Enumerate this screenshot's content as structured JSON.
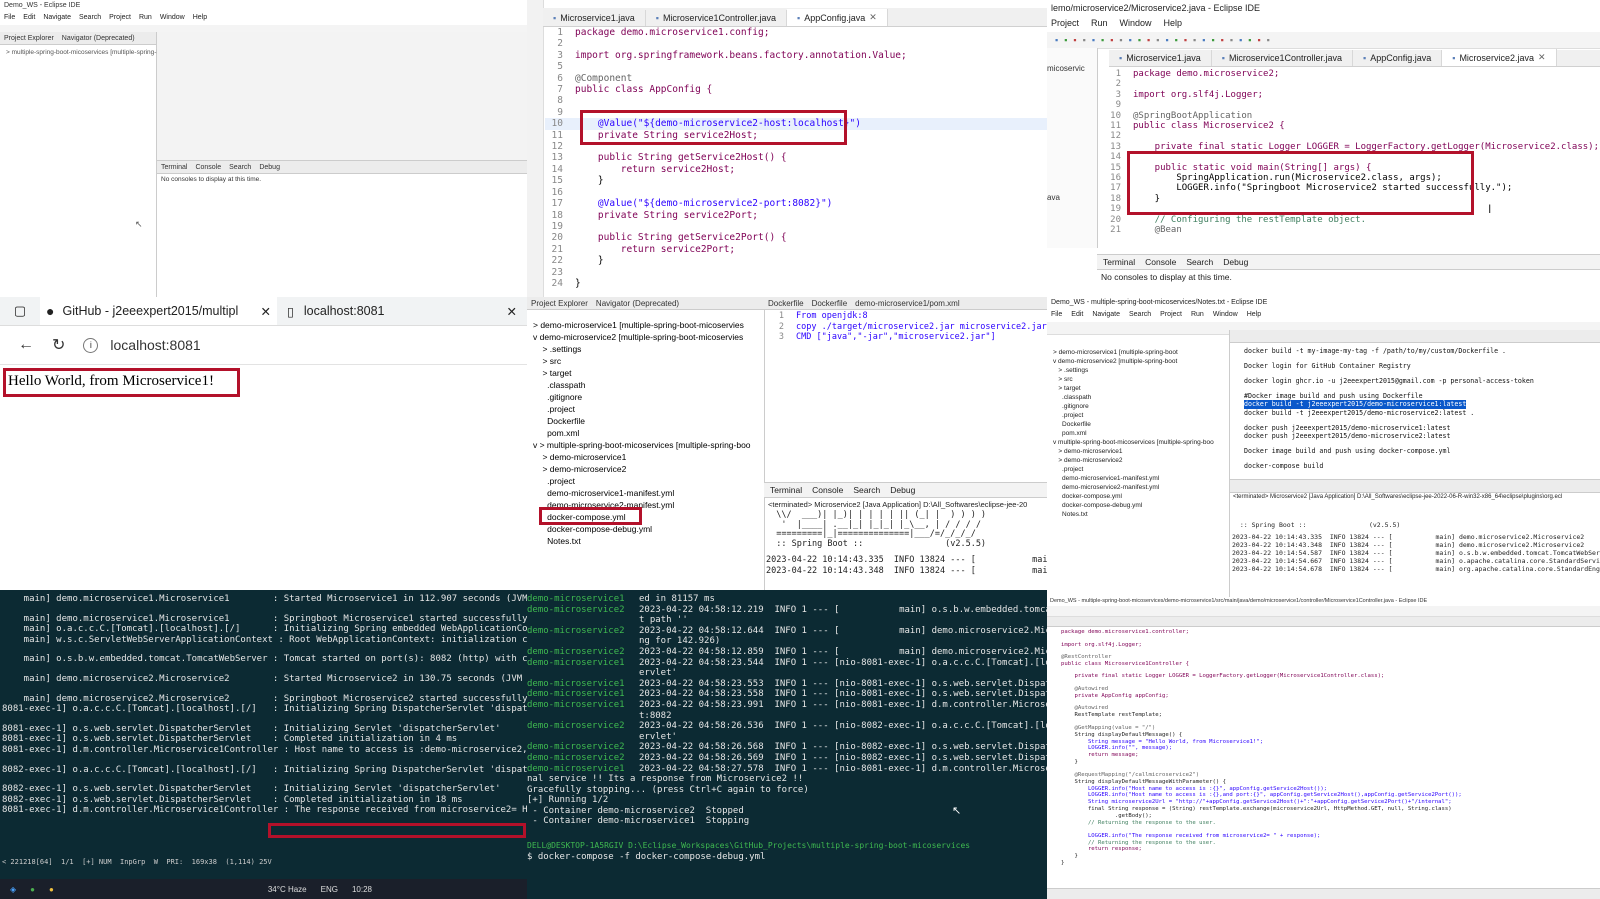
{
  "colors": {
    "highlight_box": "#b3112a",
    "terminal_bg": "#0c2a33",
    "selection": "#0a58ca"
  },
  "tl": {
    "title": "Demo_WS - Eclipse IDE",
    "menu": [
      "File",
      "Edit",
      "Navigate",
      "Search",
      "Project",
      "Run",
      "Window",
      "Help"
    ],
    "tabs": [
      "Project Explorer",
      "Navigator (Deprecated)"
    ],
    "tree_item": "> multiple-spring-boot-micoservices [multiple-spring-boo",
    "console_tabs": [
      "Terminal",
      "Console",
      "Search",
      "Debug"
    ],
    "console_msg": "No consoles to display at this time."
  },
  "tm": {
    "tabs": [
      "Microservice1.java",
      "Microservice1Controller.java",
      "AppConfig.java"
    ],
    "lines": [
      {
        "n": "1",
        "t": "package demo.microservice1.config;"
      },
      {
        "n": "2",
        "t": ""
      },
      {
        "n": "3",
        "t": "import org.springframework.beans.factory.annotation.Value;"
      },
      {
        "n": "5",
        "t": ""
      },
      {
        "n": "6",
        "t": "@Component"
      },
      {
        "n": "7",
        "t": "public class AppConfig {"
      },
      {
        "n": "8",
        "t": ""
      },
      {
        "n": "9",
        "t": ""
      },
      {
        "n": "10",
        "t": "    @Value(\"${demo-microservice2-host:localhost}\")"
      },
      {
        "n": "11",
        "t": "    private String service2Host;"
      },
      {
        "n": "12",
        "t": ""
      },
      {
        "n": "13",
        "t": "    public String getService2Host() {"
      },
      {
        "n": "14",
        "t": "        return service2Host;"
      },
      {
        "n": "15",
        "t": "    }"
      },
      {
        "n": "16",
        "t": ""
      },
      {
        "n": "17",
        "t": "    @Value(\"${demo-microservice2-port:8082}\")"
      },
      {
        "n": "18",
        "t": "    private String service2Port;"
      },
      {
        "n": "19",
        "t": ""
      },
      {
        "n": "20",
        "t": "    public String getService2Port() {"
      },
      {
        "n": "21",
        "t": "        return service2Port;"
      },
      {
        "n": "22",
        "t": "    }"
      },
      {
        "n": "23",
        "t": ""
      },
      {
        "n": "24",
        "t": "}"
      }
    ]
  },
  "tr": {
    "title": "lemo/microservice2/Microservice2.java - Eclipse IDE",
    "menu": [
      "Project",
      "Run",
      "Window",
      "Help"
    ],
    "tabs": [
      "Microservice1.java",
      "Microservice1Controller.java",
      "AppConfig.java",
      "Microservice2.java"
    ],
    "side_label": "micoservic",
    "side_label2": "ava",
    "lines": [
      {
        "n": "1",
        "t": "package demo.microservice2;"
      },
      {
        "n": "2",
        "t": ""
      },
      {
        "n": "3",
        "t": "import org.slf4j.Logger;"
      },
      {
        "n": "9",
        "t": ""
      },
      {
        "n": "10",
        "t": "@SpringBootApplication"
      },
      {
        "n": "11",
        "t": "public class Microservice2 {"
      },
      {
        "n": "12",
        "t": ""
      },
      {
        "n": "13",
        "t": "    private final static Logger LOGGER = LoggerFactory.getLogger(Microservice2.class);"
      },
      {
        "n": "14",
        "t": ""
      },
      {
        "n": "15",
        "t": "    public static void main(String[] args) {"
      },
      {
        "n": "16",
        "t": "        SpringApplication.run(Microservice2.class, args);"
      },
      {
        "n": "17",
        "t": "        LOGGER.info(\"Springboot Microservice2 started successfully.\");"
      },
      {
        "n": "18",
        "t": "    }"
      },
      {
        "n": "19",
        "t": ""
      },
      {
        "n": "20",
        "t": "    // Configuring the restTemplate object."
      },
      {
        "n": "21",
        "t": "    @Bean"
      }
    ],
    "console_tabs": [
      "Terminal",
      "Console",
      "Search",
      "Debug"
    ],
    "console_msg": "No consoles to display at this time."
  },
  "ml": {
    "tab1": "GitHub - j2eeexpert2015/multipl",
    "tab2": "localhost:8081",
    "url": "localhost:8081",
    "body": "Hello World, from Microservice1!"
  },
  "mm": {
    "tabs": [
      "Project Explorer",
      "Navigator (Deprecated)"
    ],
    "tree": [
      "> demo-microservice1 [multiple-spring-boot-micoservies",
      "v demo-microservice2 [multiple-spring-boot-micoservies",
      "    > .settings",
      "    > src",
      "    > target",
      "      .classpath",
      "      .gitignore",
      "      .project",
      "      Dockerfile",
      "      pom.xml",
      "v > multiple-spring-boot-micoservices [multiple-spring-boo",
      "    > demo-microservice1",
      "    > demo-microservice2",
      "      .project",
      "      demo-microservice1-manifest.yml",
      "      demo-microservice2-manifest.yml",
      "      docker-compose.yml",
      "      docker-compose-debug.yml",
      "      Notes.txt"
    ],
    "editor_tabs": [
      "Dockerfile",
      "Dockerfile",
      "demo-microservice1/pom.xml"
    ],
    "docker_lines": [
      {
        "n": "1",
        "t": "From openjdk:8"
      },
      {
        "n": "2",
        "t": "copy ./target/microservice2.jar microservice2.jar"
      },
      {
        "n": "3",
        "t": "CMD [\"java\",\"-jar\",\"microservice2.jar\"]"
      }
    ],
    "console_tabs": [
      "Terminal",
      "Console",
      "Search",
      "Debug"
    ],
    "console_status": "<terminated> Microservice2 [Java Application] D:\\All_Softwares\\eclipse-jee-20",
    "banner": [
      "  \\\\/  ___)| |_)| | | | | || (_| |  ) ) ) )",
      "   '  |____| .__|_| |_|_| |_\\__, | / / / /",
      "  =========|_|==============|___/=/_/_/_/",
      "  :: Spring Boot ::                (v2.5.5)"
    ],
    "log": [
      "2023-04-22 10:14:43.335  INFO 13824 --- [           main] c",
      "2023-04-22 10:14:43.348  INFO 13824 --- [           main] d"
    ]
  },
  "mr": {
    "title": "Demo_WS - multiple-spring-boot-micoservices/Notes.txt - Eclipse IDE",
    "menu": [
      "File",
      "Edit",
      "Navigate",
      "Search",
      "Project",
      "Run",
      "Window",
      "Help"
    ],
    "tree": [
      "> demo-microservice1 [multiple-spring-boot",
      "v demo-microservice2 [multiple-spring-boot",
      "   > .settings",
      "   > src",
      "   > target",
      "     .classpath",
      "     .gitignore",
      "     .project",
      "     Dockerfile",
      "     pom.xml",
      "v multiple-spring-boot-micoservices [multiple-spring-boo",
      "   > demo-microservice1",
      "   > demo-microservice2",
      "     .project",
      "     demo-microservice1-manifest.yml",
      "     demo-microservice2-manifest.yml",
      "     docker-compose.yml",
      "     docker-compose-debug.yml",
      "     Notes.txt"
    ],
    "notes": [
      "docker build -t my-image-my-tag -f /path/to/my/custom/Dockerfile .",
      "",
      "Docker login for GitHub Container Registry",
      "",
      "docker login ghcr.io -u j2eeexpert2015@gmail.com -p personal-access-token",
      "",
      "#Docker image build and push using Dockerfile",
      "docker build -t j2eeexpert2015/demo-microservice1:latest",
      "docker build -t j2eeexpert2015/demo-microservice2:latest .",
      "",
      "docker push j2eeexpert2015/demo-microservice1:latest",
      "docker push j2eeexpert2015/demo-microservice2:latest",
      "",
      "Docker image build and push using docker-compose.yml",
      "",
      "docker-compose build"
    ],
    "console_status": "<terminated> Microservice2 [Java Application] D:\\All_Softwares\\eclipse-jee-2022-06-R-win32-x86_64\\eclipse\\plugins\\org.ecl",
    "banner": "  :: Spring Boot ::                (v2.5.5)",
    "log": [
      "2023-04-22 10:14:43.335  INFO 13824 --- [           main] demo.microservice2.Microservice2",
      "2023-04-22 10:14:43.348  INFO 13824 --- [           main] demo.microservice2.Microservice2",
      "2023-04-22 10:14:54.587  INFO 13824 --- [           main] o.s.b.w.embedded.tomcat.TomcatWebServer",
      "2023-04-22 10:14:54.667  INFO 13824 --- [           main] o.apache.catalina.core.StandardService",
      "2023-04-22 10:14:54.678  INFO 13824 --- [           main] org.apache.catalina.core.StandardEngine"
    ]
  },
  "bl": {
    "lines": [
      "    main] demo.microservice1.Microservice1        : Started Microservice1 in 112.907 seconds (JVM runn",
      "",
      "    main] demo.microservice1.Microservice1        : Springboot Microservice1 started successfully.",
      "    main] o.a.c.c.C.[Tomcat].[localhost].[/]      : Initializing Spring embedded WebApplicationContext",
      "    main] w.s.c.ServletWebServerApplicationContext : Root WebApplicationContext: initialization complet",
      "",
      "    main] o.s.b.w.embedded.tomcat.TomcatWebServer : Tomcat started on port(s): 8082 (http) with contex",
      "",
      "    main] demo.microservice2.Microservice2        : Started Microservice2 in 130.75 seconds (JVM runni",
      "",
      "    main] demo.microservice2.Microservice2        : Springboot Microservice2 started successfully.",
      "8081-exec-1] o.a.c.c.C.[Tomcat].[localhost].[/]   : Initializing Spring DispatcherServlet 'dispatcherS",
      "",
      "8081-exec-1] o.s.web.servlet.DispatcherServlet    : Initializing Servlet 'dispatcherServlet'",
      "8081-exec-1] o.s.web.servlet.DispatcherServlet    : Completed initialization in 4 ms",
      "8081-exec-1] d.m.controller.Microservice1Controller : Host name to access is :demo-microservice2,and por",
      "",
      "8082-exec-1] o.a.c.c.C.[Tomcat].[localhost].[/]   : Initializing Spring DispatcherServlet 'dispatcherS",
      "",
      "8082-exec-1] o.s.web.servlet.DispatcherServlet    : Initializing Servlet 'dispatcherServlet'",
      "8082-exec-1] o.s.web.servlet.DispatcherServlet    : Completed initialization in 18 ms",
      "8081-exec-1] d.m.controller.Microservice1Controller : The response received from microservice2= Hi exter"
    ],
    "status": "< 221218[64]  1/1  [+] NUM  InpGrp  W  PRI:  169x38  (1,114) 25V",
    "weather": "34°C  Haze",
    "time": "10:28",
    "lang": "ENG"
  },
  "bm": {
    "lines": [
      {
        "svc": "demo-microservice1",
        "log": "ed in 81157 ms"
      },
      {
        "svc": "demo-microservice2",
        "log": "2023-04-22 04:58:12.219  INFO 1 --- [           main] o.s.b.w.embedded.tomcat.Tom"
      },
      {
        "svc": "",
        "log": "t path ''"
      },
      {
        "svc": "demo-microservice2",
        "log": "2023-04-22 04:58:12.644  INFO 1 --- [           main] demo.microservice2.Microse"
      },
      {
        "svc": "",
        "log": "ng for 142.926)"
      },
      {
        "svc": "demo-microservice2",
        "log": "2023-04-22 04:58:12.859  INFO 1 --- [           main] demo.microservice2.Microse"
      },
      {
        "svc": "demo-microservice1",
        "log": "2023-04-22 04:58:23.544  INFO 1 --- [nio-8081-exec-1] o.a.c.c.C.[Tomcat].[localho"
      },
      {
        "svc": "",
        "log": "ervlet'"
      },
      {
        "svc": "demo-microservice1",
        "log": "2023-04-22 04:58:23.553  INFO 1 --- [nio-8081-exec-1] o.s.web.servlet.DispatcherSe"
      },
      {
        "svc": "demo-microservice1",
        "log": "2023-04-22 04:58:23.558  INFO 1 --- [nio-8081-exec-1] o.s.web.servlet.DispatcherSe"
      },
      {
        "svc": "demo-microservice1",
        "log": "2023-04-22 04:58:23.991  INFO 1 --- [nio-8081-exec-1] d.m.controller.Microservice1"
      },
      {
        "svc": "",
        "log": "t:8082"
      },
      {
        "svc": "demo-microservice2",
        "log": "2023-04-22 04:58:26.536  INFO 1 --- [nio-8082-exec-1] o.a.c.c.C.[Tomcat].[localho"
      },
      {
        "svc": "",
        "log": "ervlet'"
      },
      {
        "svc": "demo-microservice2",
        "log": "2023-04-22 04:58:26.568  INFO 1 --- [nio-8082-exec-1] o.s.web.servlet.DispatcherSe"
      },
      {
        "svc": "demo-microservice2",
        "log": "2023-04-22 04:58:26.569  INFO 1 --- [nio-8082-exec-1] o.s.web.servlet.DispatcherSe"
      },
      {
        "svc": "demo-microservice1",
        "log": "2023-04-22 04:58:27.578  INFO 1 --- [nio-8081-exec-1] d.m.controller.Microservice1"
      }
    ],
    "tail": [
      "nal service !! Its a response from Microservice2 !!",
      "Gracefully stopping... (press Ctrl+C again to force)",
      "[+] Running 1/2",
      " - Container demo-microservice2  Stopped",
      " - Container demo-microservice1  Stopping"
    ],
    "prompt": "DELL@DESKTOP-1A5RGIV D:\\Eclipse_Workspaces\\GitHub_Projects\\multiple-spring-boot-micoservices",
    "command": "$ docker-compose -f docker-compose-debug.yml"
  },
  "br": {
    "title": "Demo_WS - multiple-spring-boot-micoservices/demo-microservice1/src/main/java/demo/microservice1/controller/Microservice1Controller.java - Eclipse IDE",
    "code": [
      "package demo.microservice1.controller;",
      "",
      "import org.slf4j.Logger;",
      "",
      "@RestController",
      "public class Microservice1Controller {",
      "",
      "    private final static Logger LOGGER = LoggerFactory.getLogger(Microservice1Controller.class);",
      "",
      "    @Autowired",
      "    private AppConfig appConfig;",
      "",
      "    @Autowired",
      "    RestTemplate restTemplate;",
      "",
      "    @GetMapping(value = \"/\")",
      "    String displayDefaultMessage() {",
      "        String message = \"Hello World, from Microservice1!\";",
      "        LOGGER.info(\"\", message);",
      "        return message;",
      "    }",
      "",
      "    @RequestMapping(\"/callmicroservice2\")",
      "    String displayDefaultMessageWithParameter() {",
      "        LOGGER.info(\"Host name to access is :{}\", appConfig.getService2Host());",
      "        LOGGER.info(\"Host name to access is :{},and port:{}\", appConfig.getService2Host(),appConfig.getService2Port());",
      "        String microservice2Url = \"http://\"+appConfig.getService2Host()+\":\"+appConfig.getService2Port()+\"/internal\";",
      "        final String response = (String) restTemplate.exchange(microservice2Url, HttpMethod.GET, null, String.class)",
      "                .getBody();",
      "        // Returning the response to the user.",
      "",
      "        LOGGER.info(\"The response received from microservice2= \" + response);",
      "        // Returning the response to the user.",
      "        return response;",
      "    }",
      "}"
    ]
  }
}
